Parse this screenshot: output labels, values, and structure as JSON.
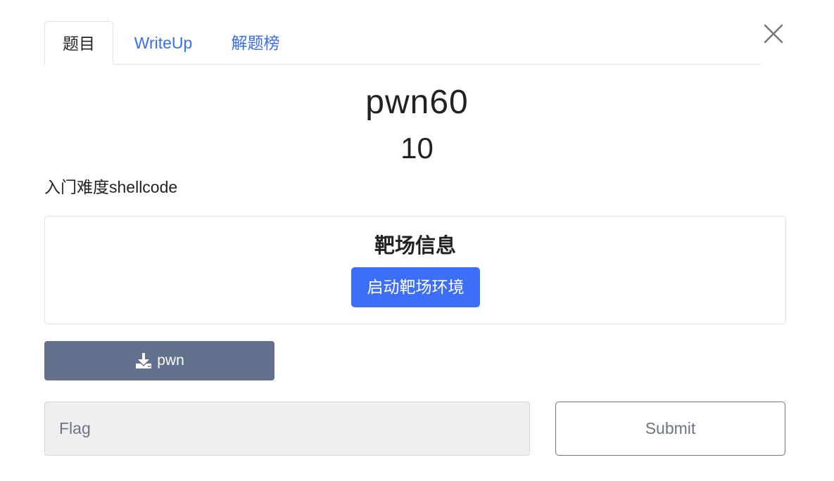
{
  "tabs": [
    {
      "label": "题目",
      "active": true
    },
    {
      "label": "WriteUp",
      "active": false
    },
    {
      "label": "解题榜",
      "active": false
    }
  ],
  "challenge": {
    "name": "pwn60",
    "value": "10",
    "description": "入门难度shellcode"
  },
  "range": {
    "title": "靶场信息",
    "start_label": "启动靶场环境"
  },
  "download": {
    "icon": "download-icon",
    "label": "pwn"
  },
  "submission": {
    "placeholder": "Flag",
    "value": "",
    "submit_label": "Submit"
  },
  "colors": {
    "link": "#3a6ef0",
    "primary": "#3d6ef7",
    "download_bg": "#64718e"
  }
}
